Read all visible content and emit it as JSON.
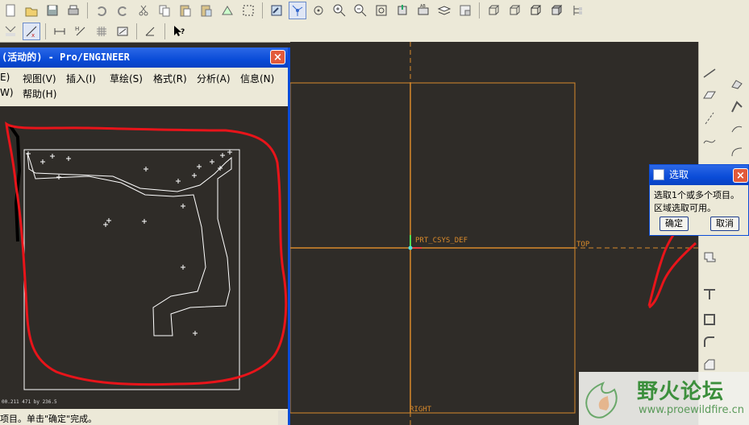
{
  "subwindow": {
    "title": "(活动的) - Pro/ENGINEER",
    "menu": [
      {
        "label": "E)"
      },
      {
        "label": "视图(V)"
      },
      {
        "label": "插入(I)"
      },
      {
        "label": "草绘(S)"
      },
      {
        "label": "格式(R)"
      },
      {
        "label": "分析(A)"
      },
      {
        "label": "信息(N)"
      },
      {
        "label": "W)"
      },
      {
        "label": "帮助(H)"
      }
    ],
    "status": "项目。单击\"确定\"完成。",
    "coord_readout": "00.211 471 by 236.5"
  },
  "viewport": {
    "csys_label": "PRT_CSYS_DEF",
    "top_label": "TOP",
    "right_label": "RIGHT"
  },
  "dialog": {
    "title": "选取",
    "line1": "选取1个或多个项目。",
    "line2": "区域选取可用。",
    "ok_label": "确定",
    "cancel_label": "取消"
  },
  "watermark": {
    "title": "野火论坛",
    "url": "www.proewildfire.cn"
  },
  "colors": {
    "background": "#2f2c28",
    "datum_orange": "#d98a2b",
    "annotation_red": "#e8141a",
    "titlebar_blue": "#0a4cd8"
  }
}
